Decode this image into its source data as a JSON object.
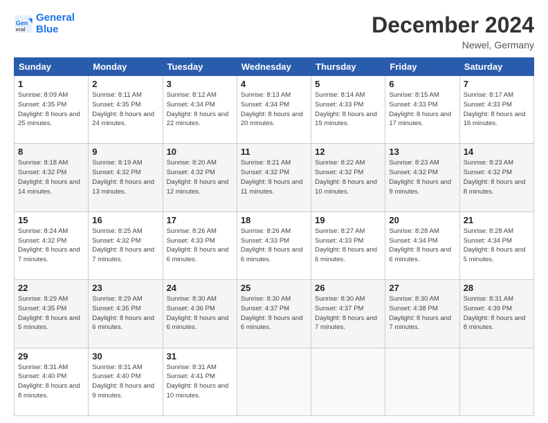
{
  "logo": {
    "line1": "General",
    "line2": "Blue"
  },
  "title": "December 2024",
  "location": "Newel, Germany",
  "headers": [
    "Sunday",
    "Monday",
    "Tuesday",
    "Wednesday",
    "Thursday",
    "Friday",
    "Saturday"
  ],
  "weeks": [
    [
      {
        "day": "1",
        "sunrise": "8:09 AM",
        "sunset": "4:35 PM",
        "daylight": "8 hours and 25 minutes."
      },
      {
        "day": "2",
        "sunrise": "8:11 AM",
        "sunset": "4:35 PM",
        "daylight": "8 hours and 24 minutes."
      },
      {
        "day": "3",
        "sunrise": "8:12 AM",
        "sunset": "4:34 PM",
        "daylight": "8 hours and 22 minutes."
      },
      {
        "day": "4",
        "sunrise": "8:13 AM",
        "sunset": "4:34 PM",
        "daylight": "8 hours and 20 minutes."
      },
      {
        "day": "5",
        "sunrise": "8:14 AM",
        "sunset": "4:33 PM",
        "daylight": "8 hours and 19 minutes."
      },
      {
        "day": "6",
        "sunrise": "8:15 AM",
        "sunset": "4:33 PM",
        "daylight": "8 hours and 17 minutes."
      },
      {
        "day": "7",
        "sunrise": "8:17 AM",
        "sunset": "4:33 PM",
        "daylight": "8 hours and 16 minutes."
      }
    ],
    [
      {
        "day": "8",
        "sunrise": "8:18 AM",
        "sunset": "4:32 PM",
        "daylight": "8 hours and 14 minutes."
      },
      {
        "day": "9",
        "sunrise": "8:19 AM",
        "sunset": "4:32 PM",
        "daylight": "8 hours and 13 minutes."
      },
      {
        "day": "10",
        "sunrise": "8:20 AM",
        "sunset": "4:32 PM",
        "daylight": "8 hours and 12 minutes."
      },
      {
        "day": "11",
        "sunrise": "8:21 AM",
        "sunset": "4:32 PM",
        "daylight": "8 hours and 11 minutes."
      },
      {
        "day": "12",
        "sunrise": "8:22 AM",
        "sunset": "4:32 PM",
        "daylight": "8 hours and 10 minutes."
      },
      {
        "day": "13",
        "sunrise": "8:23 AM",
        "sunset": "4:32 PM",
        "daylight": "8 hours and 9 minutes."
      },
      {
        "day": "14",
        "sunrise": "8:23 AM",
        "sunset": "4:32 PM",
        "daylight": "8 hours and 8 minutes."
      }
    ],
    [
      {
        "day": "15",
        "sunrise": "8:24 AM",
        "sunset": "4:32 PM",
        "daylight": "8 hours and 7 minutes."
      },
      {
        "day": "16",
        "sunrise": "8:25 AM",
        "sunset": "4:32 PM",
        "daylight": "8 hours and 7 minutes."
      },
      {
        "day": "17",
        "sunrise": "8:26 AM",
        "sunset": "4:33 PM",
        "daylight": "8 hours and 6 minutes."
      },
      {
        "day": "18",
        "sunrise": "8:26 AM",
        "sunset": "4:33 PM",
        "daylight": "8 hours and 6 minutes."
      },
      {
        "day": "19",
        "sunrise": "8:27 AM",
        "sunset": "4:33 PM",
        "daylight": "8 hours and 6 minutes."
      },
      {
        "day": "20",
        "sunrise": "8:28 AM",
        "sunset": "4:34 PM",
        "daylight": "8 hours and 6 minutes."
      },
      {
        "day": "21",
        "sunrise": "8:28 AM",
        "sunset": "4:34 PM",
        "daylight": "8 hours and 5 minutes."
      }
    ],
    [
      {
        "day": "22",
        "sunrise": "8:29 AM",
        "sunset": "4:35 PM",
        "daylight": "8 hours and 5 minutes."
      },
      {
        "day": "23",
        "sunrise": "8:29 AM",
        "sunset": "4:35 PM",
        "daylight": "8 hours and 6 minutes."
      },
      {
        "day": "24",
        "sunrise": "8:30 AM",
        "sunset": "4:36 PM",
        "daylight": "8 hours and 6 minutes."
      },
      {
        "day": "25",
        "sunrise": "8:30 AM",
        "sunset": "4:37 PM",
        "daylight": "8 hours and 6 minutes."
      },
      {
        "day": "26",
        "sunrise": "8:30 AM",
        "sunset": "4:37 PM",
        "daylight": "8 hours and 7 minutes."
      },
      {
        "day": "27",
        "sunrise": "8:30 AM",
        "sunset": "4:38 PM",
        "daylight": "8 hours and 7 minutes."
      },
      {
        "day": "28",
        "sunrise": "8:31 AM",
        "sunset": "4:39 PM",
        "daylight": "8 hours and 8 minutes."
      }
    ],
    [
      {
        "day": "29",
        "sunrise": "8:31 AM",
        "sunset": "4:40 PM",
        "daylight": "8 hours and 8 minutes."
      },
      {
        "day": "30",
        "sunrise": "8:31 AM",
        "sunset": "4:40 PM",
        "daylight": "8 hours and 9 minutes."
      },
      {
        "day": "31",
        "sunrise": "8:31 AM",
        "sunset": "4:41 PM",
        "daylight": "8 hours and 10 minutes."
      },
      null,
      null,
      null,
      null
    ]
  ],
  "labels": {
    "sunrise": "Sunrise:",
    "sunset": "Sunset:",
    "daylight": "Daylight:"
  }
}
